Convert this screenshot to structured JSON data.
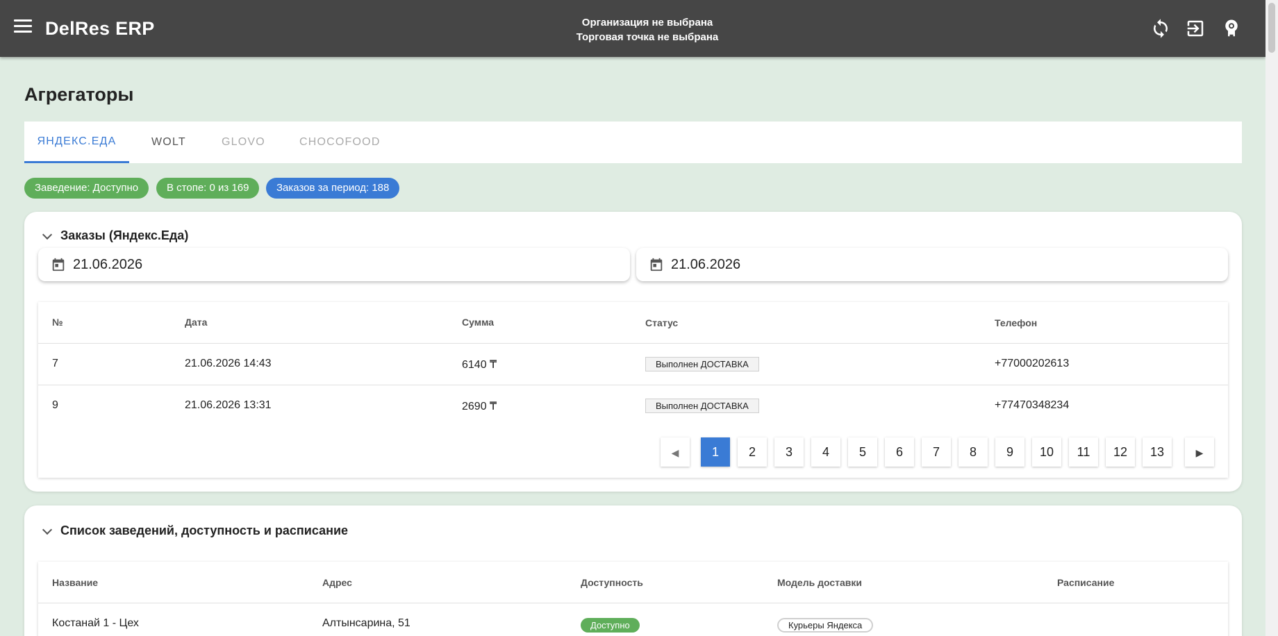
{
  "header": {
    "app_title": "DelRes ERP",
    "org_line1": "Организация не выбрана",
    "org_line2": "Торговая точка не выбрана",
    "icons": [
      "menu-icon",
      "refresh-icon",
      "logout-icon",
      "settings-icon"
    ]
  },
  "page": {
    "title": "Агрегаторы"
  },
  "tabs": [
    {
      "label": "ЯНДЕКС.ЕДА",
      "state": "active"
    },
    {
      "label": "WOLT",
      "state": "enabled"
    },
    {
      "label": "GLOVO",
      "state": "disabled"
    },
    {
      "label": "CHOCOFOOD",
      "state": "disabled"
    }
  ],
  "chips": [
    {
      "label": "Заведение: Доступно",
      "color": "#5fae5a"
    },
    {
      "label": "В стопе: 0 из 169",
      "color": "#5fae5a"
    },
    {
      "label": "Заказов за период: 188",
      "color": "#3a7bd5"
    }
  ],
  "orders": {
    "title": "Заказы (Яндекс.Еда)",
    "date_from": "21.06.2026",
    "date_to": "21.06.2026",
    "columns": [
      "№",
      "Дата",
      "Сумма",
      "Статус",
      "Телефон"
    ],
    "rows": [
      {
        "num": "7",
        "date": "21.06.2026 14:43",
        "sum": "6140 ₸",
        "status": "Выполнен ДОСТАВКА",
        "phone": "+77000202613"
      },
      {
        "num": "9",
        "date": "21.06.2026 13:31",
        "sum": "2690 ₸",
        "status": "Выполнен ДОСТАВКА",
        "phone": "+77470348234"
      }
    ],
    "pagination": {
      "current": "1",
      "pages": [
        "1",
        "2",
        "3",
        "4",
        "5",
        "6",
        "7",
        "8",
        "9",
        "10",
        "11",
        "12",
        "13"
      ]
    }
  },
  "venues": {
    "title": "Список заведений, доступность и расписание",
    "columns": [
      "Название",
      "Адрес",
      "Доступность",
      "Модель доставки",
      "Расписание"
    ],
    "rows": [
      {
        "name": "Костанай 1 - Цех",
        "address": "Алтынсарина, 51",
        "availability": "Доступно",
        "delivery_model": "Курьеры Яндекса",
        "schedule": ""
      }
    ]
  },
  "colors": {
    "topbar": "#464646",
    "background": "#dfece2",
    "accent": "#3a7bd5",
    "success": "#5fae5a"
  }
}
